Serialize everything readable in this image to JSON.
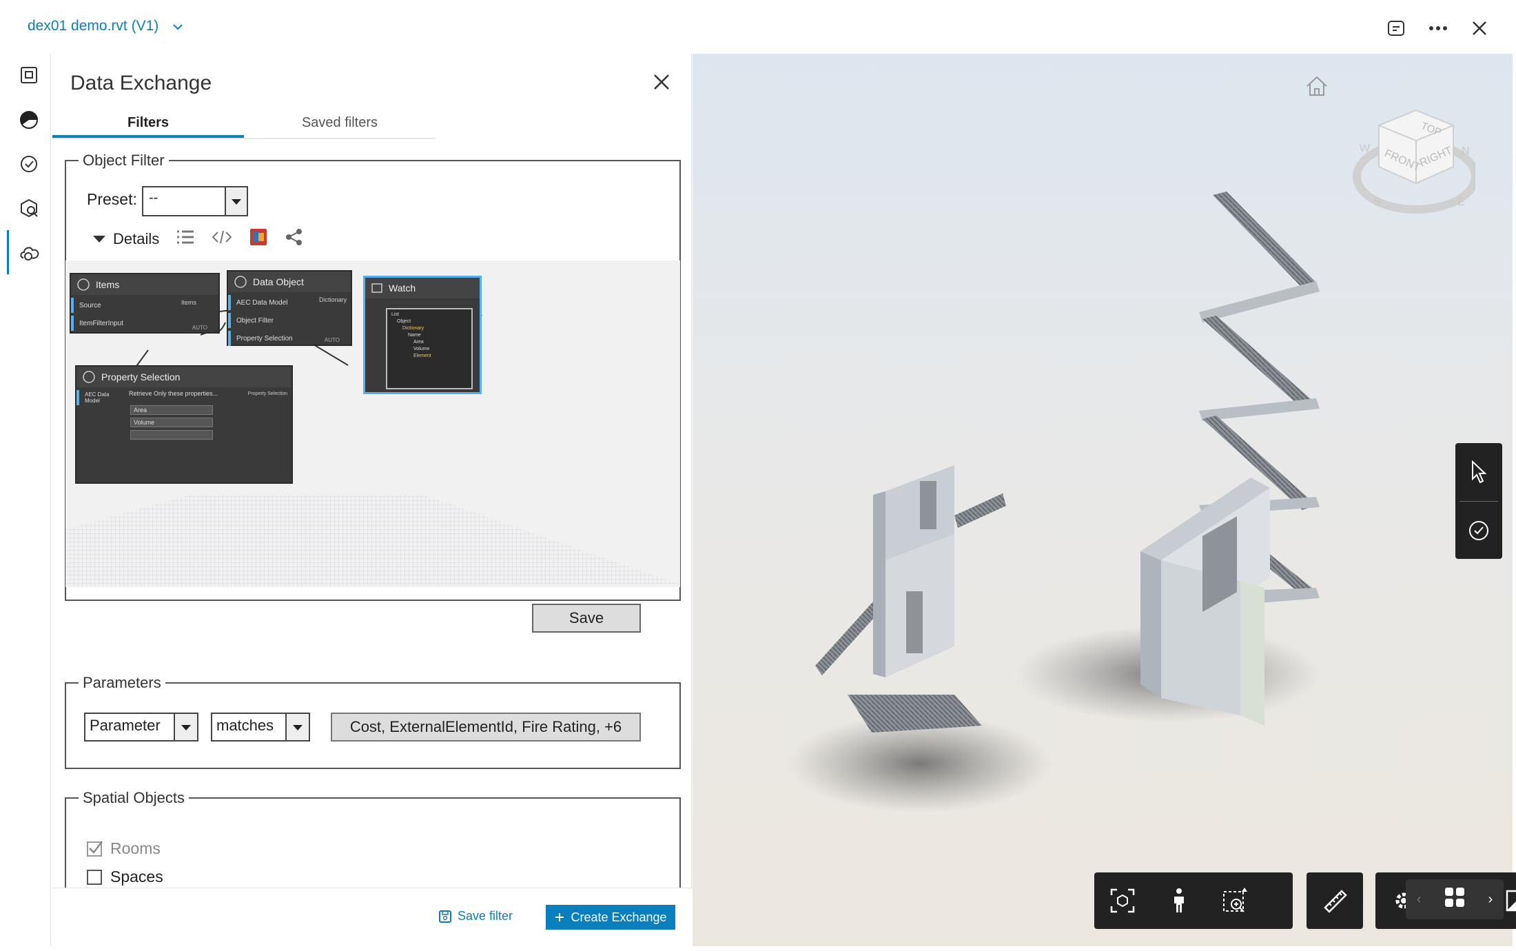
{
  "file": {
    "title": "dex01 demo.rvt",
    "version": "(V1)"
  },
  "panel": {
    "title": "Data Exchange",
    "tabs": [
      {
        "label": "Filters"
      },
      {
        "label": "Saved filters"
      }
    ]
  },
  "object_filter": {
    "legend": "Object Filter",
    "preset_label": "Preset:",
    "preset_value": "--",
    "details_label": "Details",
    "save_label": "Save",
    "graph": {
      "items_title": "Items",
      "items_ports": [
        "Source",
        "ItemFilterInput"
      ],
      "items_output": "Items",
      "items_status": "AUTO",
      "data_object_title": "Data Object",
      "data_object_ports": [
        "AEC Data Model",
        "Object Filter",
        "Property Selection"
      ],
      "data_object_output": "Dictionary",
      "data_object_status": "AUTO",
      "watch_title": "Watch",
      "watch_lines": [
        "List",
        "Object",
        "Dictionary",
        "Name",
        "Area",
        "Volume",
        "Element"
      ],
      "prop_title": "Property Selection",
      "prop_input": "AEC Data Model",
      "prop_caption": "Retrieve Only these properties...",
      "prop_rows": [
        "Area",
        "Volume",
        ""
      ],
      "prop_output": "Property Selection"
    }
  },
  "parameters": {
    "legend": "Parameters",
    "field": "Parameter",
    "operator": "matches",
    "value": "Cost, ExternalElementId, Fire Rating, +6"
  },
  "spatial": {
    "legend": "Spatial Objects",
    "items": [
      {
        "label": "Rooms",
        "checked": true,
        "disabled": true
      },
      {
        "label": "Spaces",
        "checked": false,
        "disabled": false
      }
    ]
  },
  "footer": {
    "save_filter": "Save filter",
    "create_exchange": "Create Exchange"
  },
  "viewcube": {
    "top": "TOP",
    "front": "FRONT",
    "right": "RIGHT",
    "n": "N",
    "w": "W",
    "s": "S",
    "e": "E"
  },
  "colors": {
    "accent": "#0a7fbd",
    "toolbar": "#222222"
  }
}
